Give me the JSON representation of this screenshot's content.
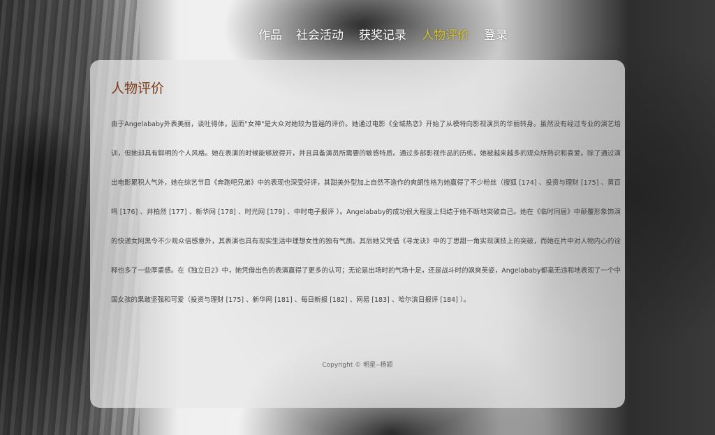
{
  "nav": {
    "items": [
      {
        "label": "作品",
        "active": false
      },
      {
        "label": "社会活动",
        "active": false
      },
      {
        "label": "获奖记录",
        "active": false
      },
      {
        "label": "人物评价",
        "active": true
      },
      {
        "label": "登录",
        "active": false
      }
    ],
    "active_color": "#d9c730"
  },
  "section": {
    "title": "人物评价",
    "title_color": "#7a3a18",
    "body": "由于Angelababy外表美丽，谈吐得体，因而\"女神\"是大众对她较为普遍的评价。她通过电影《全城热恋》开始了从模特向影视演员的华丽转身。虽然没有经过专业的演艺培训，但她却具有鲜明的个人风格。她在表演的时候能够放得开，并且具备演员所需要的敏感特质。通过多部影视作品的历练，她被越来越多的观众所熟识和喜爱。除了通过演出电影累积人气外，她在综艺节目《奔跑吧兄弟》中的表现也深受好评，其甜美外型加上自然不造作的爽朗性格为她赢得了不少粉丝（搜狐 [174] 、投资与理财 [175] 、黄百鸣 [176] 、井柏然 [177] 、新华网 [178] 、时光网 [179] 、中时电子报评 ）。Angelababy的成功很大程度上归结于她不断地突破自己。她在《临时同居》中颠覆形象饰演的快递女阿黑令不少观众倍感意外，其表演也具有现实生活中理想女性的独有气质。其后她又凭借《寻龙诀》中的丁思甜一角实现演技上的突破，而她在片中对人物内心的诠释也多了一些厚重感。在《独立日2》中，她凭借出色的表演赢得了更多的认可；无论是出场时的气场十足，还是战斗时的飒爽英姿，Angelababy都毫无违和地表现了一个中国女孩的果敢坚强和可爱（投资与理财 [175] 、新华网 [181] 、每日新报 [182] 、网易 [183] 、哈尔滨日报评 [184] ）。"
  },
  "footer": {
    "text": "Copyright © 明星--杨颖"
  }
}
